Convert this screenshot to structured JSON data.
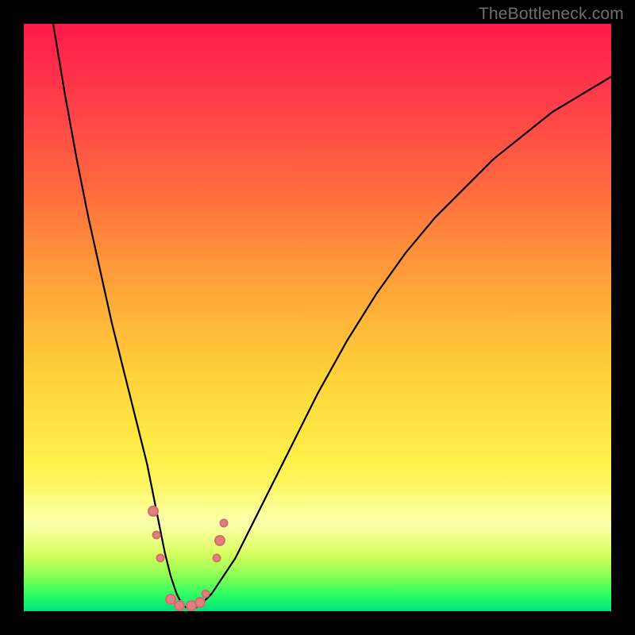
{
  "watermark": "TheBottleneck.com",
  "chart_data": {
    "type": "line",
    "title": "",
    "xlabel": "",
    "ylabel": "",
    "xlim": [
      0,
      100
    ],
    "ylim": [
      0,
      100
    ],
    "grid": false,
    "legend": false,
    "series": [
      {
        "name": "curve",
        "x": [
          5,
          7,
          9,
          11,
          13,
          15,
          17,
          19,
          20,
          21,
          22,
          23,
          24,
          25,
          26,
          27,
          28,
          29,
          30,
          32,
          36,
          40,
          45,
          50,
          55,
          60,
          65,
          70,
          75,
          80,
          85,
          90,
          95,
          100
        ],
        "values": [
          100,
          88,
          77,
          67,
          58,
          49,
          41,
          33,
          29,
          25,
          20,
          15,
          10,
          6,
          3,
          1,
          0.5,
          0.5,
          1,
          3,
          9,
          17,
          27,
          37,
          46,
          54,
          61,
          67,
          72,
          77,
          81,
          85,
          88,
          91
        ]
      }
    ],
    "markers": [
      {
        "x": 22.0,
        "y": 17,
        "size": 14
      },
      {
        "x": 22.6,
        "y": 13,
        "size": 11
      },
      {
        "x": 23.2,
        "y": 9,
        "size": 11
      },
      {
        "x": 25.0,
        "y": 2,
        "size": 14
      },
      {
        "x": 26.5,
        "y": 1,
        "size": 14
      },
      {
        "x": 28.5,
        "y": 1,
        "size": 14
      },
      {
        "x": 30.0,
        "y": 1.5,
        "size": 14
      },
      {
        "x": 31.0,
        "y": 3,
        "size": 11
      },
      {
        "x": 32.8,
        "y": 9,
        "size": 11
      },
      {
        "x": 33.4,
        "y": 12,
        "size": 14
      },
      {
        "x": 34.0,
        "y": 15,
        "size": 11
      }
    ],
    "gradient_stops": {
      "top": "#ff1a4b",
      "mid_upper": "#ff6a3f",
      "mid": "#ffd23a",
      "mid_lower": "#faff7a",
      "bottom": "#00e27e"
    }
  }
}
